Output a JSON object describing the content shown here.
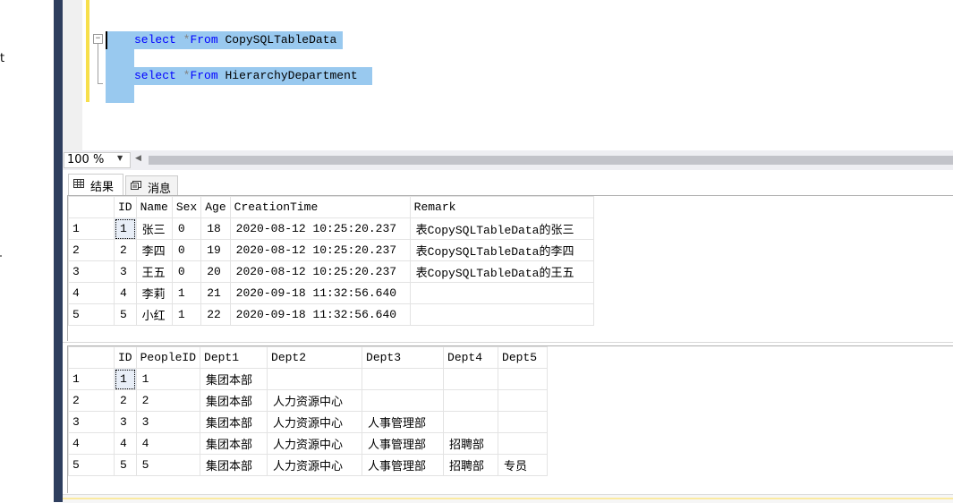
{
  "explorer": {
    "fragment": "t"
  },
  "editor": {
    "lines": [
      {
        "kw": "select",
        "op": "*",
        "kw2": "From",
        "table": "CopySQLTableData"
      },
      {
        "kw": "select",
        "op": "*",
        "kw2": "From",
        "table": "HierarchyDepartment"
      }
    ],
    "collapse_glyph": "−"
  },
  "zoom": {
    "value": "100 %",
    "arrow": "▼",
    "scroll_left": "◀"
  },
  "tabs": [
    {
      "label": "结果",
      "icon": "grid-icon"
    },
    {
      "label": "消息",
      "icon": "messages-icon"
    }
  ],
  "result1": {
    "columns": [
      "ID",
      "Name",
      "Sex",
      "Age",
      "CreationTime",
      "Remark"
    ],
    "rows": [
      {
        "n": "1",
        "cells": [
          "1",
          "张三",
          "0",
          "18",
          "2020-08-12 10:25:20.237",
          "表CopySQLTableData的张三"
        ]
      },
      {
        "n": "2",
        "cells": [
          "2",
          "李四",
          "0",
          "19",
          "2020-08-12 10:25:20.237",
          "表CopySQLTableData的李四"
        ]
      },
      {
        "n": "3",
        "cells": [
          "3",
          "王五",
          "0",
          "20",
          "2020-08-12 10:25:20.237",
          "表CopySQLTableData的王五"
        ]
      },
      {
        "n": "4",
        "cells": [
          "4",
          "李莉",
          "1",
          "21",
          "2020-09-18 11:32:56.640",
          ""
        ]
      },
      {
        "n": "5",
        "cells": [
          "5",
          "小红",
          "1",
          "22",
          "2020-09-18 11:32:56.640",
          ""
        ]
      }
    ]
  },
  "result2": {
    "columns": [
      "ID",
      "PeopleID",
      "Dept1",
      "Dept2",
      "Dept3",
      "Dept4",
      "Dept5"
    ],
    "rows": [
      {
        "n": "1",
        "cells": [
          "1",
          "1",
          "集团本部",
          "",
          "",
          "",
          ""
        ]
      },
      {
        "n": "2",
        "cells": [
          "2",
          "2",
          "集团本部",
          "人力资源中心",
          "",
          "",
          ""
        ]
      },
      {
        "n": "3",
        "cells": [
          "3",
          "3",
          "集团本部",
          "人力资源中心",
          "人事管理部",
          "",
          ""
        ]
      },
      {
        "n": "4",
        "cells": [
          "4",
          "4",
          "集团本部",
          "人力资源中心",
          "人事管理部",
          "招聘部",
          ""
        ]
      },
      {
        "n": "5",
        "cells": [
          "5",
          "5",
          "集团本部",
          "人力资源中心",
          "人事管理部",
          "招聘部",
          "专员"
        ]
      }
    ]
  }
}
